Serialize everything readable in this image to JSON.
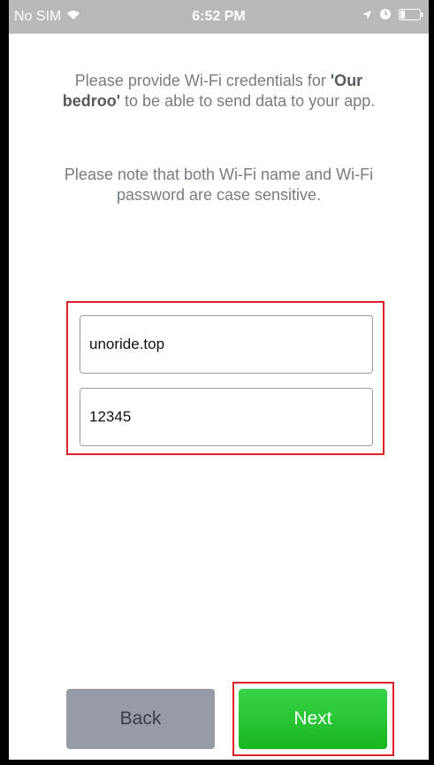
{
  "status_bar": {
    "carrier": "No SIM",
    "time": "6:52 PM"
  },
  "intro": {
    "before": "Please provide Wi-Fi credentials for ",
    "device_name": "'Our bedroo'",
    "after": " to be able to send data to your app."
  },
  "note": "Please note that both Wi-Fi name and Wi-Fi password are case sensitive.",
  "form": {
    "wifi_name": "unoride.top",
    "wifi_password": "12345"
  },
  "buttons": {
    "back_label": "Back",
    "next_label": "Next"
  },
  "colors": {
    "highlight": "#e01f2c",
    "next_button": "#1fc22a",
    "back_button": "#979ba6"
  }
}
